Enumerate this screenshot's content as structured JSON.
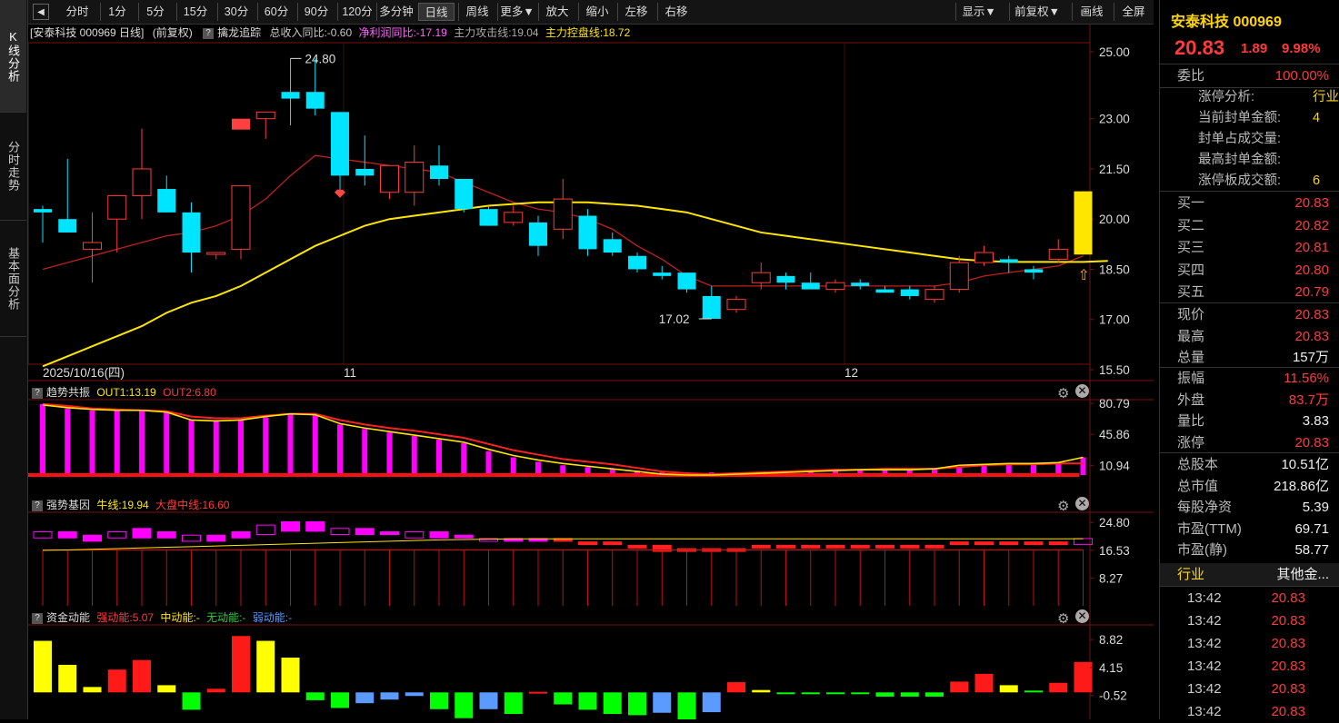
{
  "sidebar": {
    "tabs": [
      {
        "label": "K线分析",
        "active": true
      },
      {
        "label": "分时走势",
        "active": false
      },
      {
        "label": "基本面分析",
        "active": false
      }
    ]
  },
  "toolbar": {
    "back_icon": "◀",
    "periods": [
      "分时",
      "1分",
      "5分",
      "15分",
      "30分",
      "60分",
      "90分",
      "120分",
      "多分钟",
      "日线",
      "周线",
      "更多▼"
    ],
    "selected_period": "日线",
    "tools": [
      "放大",
      "缩小",
      "左移",
      "右移"
    ],
    "right_tools": [
      "显示▼",
      "前复权▼",
      "画线",
      "全屏"
    ]
  },
  "main_chart": {
    "header": {
      "stock": "[安泰科技 000969 日线]",
      "adjust": "(前复权)",
      "indicator": "擒龙追踪",
      "rev": "总收入同比:-0.60",
      "profit": "净利润同比:-17.19",
      "attack": "主力攻击线:19.04",
      "control": "主力控盘线:18.72"
    },
    "y_ticks": [
      "25.00",
      "23.00",
      "21.50",
      "20.00",
      "18.50",
      "17.00",
      "15.50"
    ],
    "high_label": "24.80",
    "low_label": "17.02",
    "date_labels": [
      "2025/10/16(四)",
      "11",
      "12"
    ]
  },
  "chart_data": [
    {
      "type": "candlestick",
      "title": "安泰科技 000969 日线",
      "ylim": [
        15.5,
        25.0
      ],
      "candles": [
        {
          "o": 20.3,
          "h": 20.4,
          "l": 19.3,
          "c": 20.2
        },
        {
          "o": 20.0,
          "h": 21.8,
          "l": 19.6,
          "c": 19.6
        },
        {
          "o": 19.1,
          "h": 20.2,
          "l": 18.1,
          "c": 19.3
        },
        {
          "o": 20.0,
          "h": 20.7,
          "l": 19.0,
          "c": 20.7
        },
        {
          "o": 20.7,
          "h": 22.7,
          "l": 20.0,
          "c": 21.5
        },
        {
          "o": 20.9,
          "h": 21.3,
          "l": 20.2,
          "c": 20.2
        },
        {
          "o": 20.2,
          "h": 20.5,
          "l": 18.4,
          "c": 19.0
        },
        {
          "o": 19.0,
          "h": 19.0,
          "l": 18.8,
          "c": 19.0
        },
        {
          "o": 19.1,
          "h": 21.0,
          "l": 18.8,
          "c": 21.0
        },
        {
          "o": 23.0,
          "h": 23.1,
          "l": 22.4,
          "c": 23.2
        },
        {
          "o": 23.8,
          "h": 24.8,
          "l": 22.8,
          "c": 23.6
        },
        {
          "o": 23.8,
          "h": 24.8,
          "l": 23.1,
          "c": 23.3
        },
        {
          "o": 23.2,
          "h": 23.2,
          "l": 20.8,
          "c": 21.3
        },
        {
          "o": 21.5,
          "h": 22.5,
          "l": 21.0,
          "c": 21.3
        },
        {
          "o": 20.8,
          "h": 21.6,
          "l": 20.6,
          "c": 21.6
        },
        {
          "o": 20.8,
          "h": 22.2,
          "l": 20.4,
          "c": 21.7
        },
        {
          "o": 21.6,
          "h": 22.2,
          "l": 21.0,
          "c": 21.2
        },
        {
          "o": 21.2,
          "h": 21.2,
          "l": 20.2,
          "c": 20.3
        },
        {
          "o": 20.3,
          "h": 20.4,
          "l": 19.8,
          "c": 19.8
        },
        {
          "o": 19.9,
          "h": 20.4,
          "l": 19.8,
          "c": 20.2
        },
        {
          "o": 19.9,
          "h": 20.1,
          "l": 18.9,
          "c": 19.2
        },
        {
          "o": 19.7,
          "h": 21.2,
          "l": 19.4,
          "c": 20.6
        },
        {
          "o": 20.1,
          "h": 20.3,
          "l": 18.9,
          "c": 19.1
        },
        {
          "o": 19.4,
          "h": 19.6,
          "l": 18.9,
          "c": 19.0
        },
        {
          "o": 18.9,
          "h": 19.0,
          "l": 18.4,
          "c": 18.5
        },
        {
          "o": 18.4,
          "h": 18.6,
          "l": 18.2,
          "c": 18.3
        },
        {
          "o": 18.4,
          "h": 18.4,
          "l": 17.8,
          "c": 17.9
        },
        {
          "o": 17.7,
          "h": 18.0,
          "l": 17.02,
          "c": 17.02
        },
        {
          "o": 17.3,
          "h": 17.7,
          "l": 17.2,
          "c": 17.6
        },
        {
          "o": 18.1,
          "h": 18.7,
          "l": 17.9,
          "c": 18.4
        },
        {
          "o": 18.3,
          "h": 18.4,
          "l": 17.9,
          "c": 18.1
        },
        {
          "o": 18.1,
          "h": 18.4,
          "l": 17.9,
          "c": 17.9
        },
        {
          "o": 17.9,
          "h": 18.2,
          "l": 17.8,
          "c": 18.1
        },
        {
          "o": 18.1,
          "h": 18.2,
          "l": 17.9,
          "c": 18.0
        },
        {
          "o": 17.9,
          "h": 18.0,
          "l": 17.8,
          "c": 17.8
        },
        {
          "o": 17.9,
          "h": 18.0,
          "l": 17.6,
          "c": 17.7
        },
        {
          "o": 17.6,
          "h": 18.0,
          "l": 17.5,
          "c": 17.9
        },
        {
          "o": 17.9,
          "h": 18.9,
          "l": 17.8,
          "c": 18.7
        },
        {
          "o": 18.7,
          "h": 19.2,
          "l": 18.6,
          "c": 19.0
        },
        {
          "o": 18.8,
          "h": 18.9,
          "l": 18.4,
          "c": 18.7
        },
        {
          "o": 18.5,
          "h": 18.6,
          "l": 18.2,
          "c": 18.4
        },
        {
          "o": 18.8,
          "h": 19.4,
          "l": 18.7,
          "c": 19.1
        },
        {
          "o": 18.94,
          "h": 20.83,
          "l": 18.94,
          "c": 20.83
        }
      ],
      "ma_fast": [
        18.5,
        18.7,
        18.9,
        19.1,
        19.3,
        19.5,
        19.6,
        19.8,
        20.1,
        20.6,
        21.3,
        21.9,
        21.8,
        21.7,
        21.6,
        21.5,
        21.4,
        21.1,
        20.8,
        20.5,
        20.3,
        20.2,
        20.0,
        19.7,
        19.2,
        18.8,
        18.3,
        18.0,
        18.0,
        18.0,
        18.0,
        18.0,
        18.0,
        18.0,
        18.0,
        18.0,
        18.0,
        18.1,
        18.3,
        18.4,
        18.5,
        18.6,
        18.9
      ],
      "ma_slow": [
        15.6,
        15.9,
        16.2,
        16.5,
        16.8,
        17.2,
        17.5,
        17.7,
        18.0,
        18.4,
        18.8,
        19.2,
        19.5,
        19.8,
        20.0,
        20.1,
        20.2,
        20.3,
        20.4,
        20.45,
        20.5,
        20.5,
        20.5,
        20.45,
        20.4,
        20.3,
        20.2,
        20.0,
        19.8,
        19.6,
        19.5,
        19.4,
        19.3,
        19.2,
        19.1,
        19.0,
        18.9,
        18.8,
        18.75,
        18.72,
        18.72,
        18.72,
        18.72,
        18.75
      ]
    },
    {
      "type": "bar",
      "title": "趋势共振",
      "series": [
        {
          "name": "OUT1",
          "value_label": "13.19"
        },
        {
          "name": "OUT2",
          "value_label": "6.80"
        }
      ],
      "y_ticks": [
        "80.79",
        "45.86",
        "10.94"
      ],
      "ylim": [
        0,
        84
      ],
      "values": [
        80,
        75,
        73,
        73,
        73,
        72,
        62,
        62,
        62,
        65,
        69,
        69,
        57,
        52,
        48,
        44,
        40,
        36,
        27,
        20,
        15,
        11,
        9,
        7,
        5,
        3,
        3,
        3,
        3,
        3,
        4,
        5,
        5,
        6,
        6,
        6,
        7,
        9,
        11,
        12,
        13,
        13,
        20
      ],
      "line1": [
        79,
        76,
        74,
        73,
        73,
        71,
        62,
        61,
        62,
        66,
        69,
        68,
        58,
        53,
        49,
        45,
        41,
        37,
        29,
        22,
        17,
        13,
        10,
        7,
        4,
        1,
        0,
        0,
        1,
        2,
        3,
        4,
        5,
        6,
        6,
        6,
        7,
        11,
        12,
        13,
        13,
        14,
        20
      ],
      "line2": [
        80,
        78,
        75,
        74,
        73,
        72,
        66,
        64,
        64,
        67,
        69,
        69,
        62,
        57,
        53,
        50,
        46,
        42,
        35,
        28,
        23,
        18,
        15,
        12,
        8,
        4,
        2,
        1,
        2,
        3,
        4,
        5,
        6,
        6,
        7,
        7,
        7,
        9,
        11,
        12,
        12,
        13,
        13
      ]
    },
    {
      "type": "bar",
      "title": "强势基因",
      "series": [
        {
          "name": "牛线",
          "value_label": "19.94"
        },
        {
          "name": "大盘中线",
          "value_label": "16.60"
        }
      ],
      "y_ticks": [
        "24.80",
        "16.53",
        "8.27"
      ],
      "ylim": [
        0,
        27
      ],
      "values_top": [
        22,
        22,
        21,
        22,
        23,
        22,
        21,
        21,
        22,
        24,
        25,
        25,
        23,
        23,
        22,
        22,
        22,
        21,
        20,
        20,
        20,
        20,
        19,
        19,
        18,
        18,
        17,
        17,
        17,
        18,
        18,
        18,
        18,
        18,
        18,
        18,
        18,
        19,
        19,
        19,
        19,
        19,
        20
      ],
      "values_bottom": [
        21,
        21,
        20,
        21,
        21,
        21,
        20,
        20,
        21,
        22,
        23,
        23,
        22,
        22,
        22,
        21,
        21,
        21,
        20,
        20,
        20,
        20,
        19,
        19,
        18,
        17,
        17,
        17,
        17,
        18,
        18,
        18,
        18,
        18,
        18,
        18,
        18,
        19,
        19,
        19,
        19,
        19,
        19
      ],
      "line_bull": [
        16.5,
        16.6,
        16.8,
        17.0,
        17.2,
        17.4,
        17.6,
        17.8,
        18.0,
        18.2,
        18.4,
        18.6,
        18.8,
        19.0,
        19.2,
        19.4,
        19.6,
        19.7,
        19.8,
        19.9,
        19.9,
        19.9,
        19.9,
        19.9,
        19.9,
        19.9,
        19.9,
        19.9,
        19.9,
        19.9,
        19.9,
        19.9,
        19.9,
        19.9,
        19.9,
        19.9,
        19.9,
        19.9,
        19.9,
        19.9,
        19.9,
        19.9,
        19.94
      ],
      "line_mid": [
        16.6,
        16.6,
        16.6,
        16.6,
        16.6,
        16.6,
        16.6,
        16.6,
        16.6,
        16.6,
        16.6,
        16.6,
        16.6,
        16.6,
        16.6,
        16.6,
        16.6,
        16.6,
        16.6,
        16.6,
        16.6,
        16.6,
        16.6,
        16.6,
        16.6,
        16.6,
        16.6,
        16.6,
        16.6,
        16.6,
        16.6,
        16.6,
        16.6,
        16.6,
        16.6,
        16.6,
        16.6,
        16.6,
        16.6,
        16.6,
        16.6,
        16.6,
        16.6
      ]
    },
    {
      "type": "bar",
      "title": "资金动能",
      "series": [
        {
          "name": "强动能",
          "value_label": "5.07"
        },
        {
          "name": "中动能",
          "value_label": "-"
        },
        {
          "name": "无动能",
          "value_label": "-"
        },
        {
          "name": "弱动能",
          "value_label": "-"
        }
      ],
      "y_ticks": [
        "8.82",
        "4.15",
        "-0.52"
      ],
      "ylim": [
        -4.5,
        10.5
      ],
      "values": [
        8.6,
        4.6,
        0.9,
        3.8,
        5.4,
        1.2,
        -2.9,
        0.6,
        9.4,
        8.6,
        5.8,
        -1.3,
        -2.6,
        -1.8,
        -1.2,
        -0.6,
        -2.8,
        -4.3,
        -2.8,
        -3.6,
        0.1,
        -2.0,
        -2.9,
        -3.6,
        -3.8,
        -3.4,
        -4.5,
        -3.3,
        1.7,
        0.4,
        -0.2,
        -0.2,
        -0.2,
        -0.2,
        -0.7,
        -0.7,
        -0.7,
        1.8,
        3.1,
        1.2,
        0.3,
        1.6,
        5.07
      ],
      "colors": [
        "yellow",
        "yellow",
        "yellow",
        "red",
        "red",
        "yellow",
        "green",
        "red",
        "red",
        "yellow",
        "yellow",
        "green",
        "green",
        "blue",
        "blue",
        "blue",
        "green",
        "green",
        "blue",
        "green",
        "red",
        "green",
        "green",
        "green",
        "green",
        "blue",
        "green",
        "blue",
        "red",
        "yellow",
        "green",
        "green",
        "green",
        "green",
        "green",
        "green",
        "green",
        "red",
        "red",
        "yellow",
        "green",
        "red",
        "red"
      ]
    }
  ],
  "panels": {
    "trend": {
      "title": "趋势共振",
      "out1": "OUT1:13.19",
      "out2": "OUT2:6.80"
    },
    "gene": {
      "title": "强势基因",
      "bull": "牛线:19.94",
      "mid": "大盘中线:16.60"
    },
    "fund": {
      "title": "资金动能",
      "strong": "强动能:5.07",
      "medium": "中动能:-",
      "none": "无动能:-",
      "weak": "弱动能:-"
    }
  },
  "right_panel": {
    "title": "安泰科技 000969",
    "price": "20.83",
    "change": "1.89",
    "pct": "9.98%",
    "weibi_label": "委比",
    "weibi_value": "100.00%",
    "limit_info": [
      {
        "label": "涨停分析:",
        "value": "行业"
      },
      {
        "label": "当前封单金额:",
        "value": "4"
      },
      {
        "label": "封单占成交量:",
        "value": ""
      },
      {
        "label": "最高封单金额:",
        "value": ""
      },
      {
        "label": "涨停板成交额:",
        "value": "6"
      }
    ],
    "bids": [
      {
        "label": "买一",
        "value": "20.83"
      },
      {
        "label": "买二",
        "value": "20.82"
      },
      {
        "label": "买三",
        "value": "20.81"
      },
      {
        "label": "买四",
        "value": "20.80"
      },
      {
        "label": "买五",
        "value": "20.79"
      }
    ],
    "quotes": [
      {
        "label": "现价",
        "value": "20.83",
        "color": "red"
      },
      {
        "label": "最高",
        "value": "20.83",
        "color": "red"
      },
      {
        "label": "总量",
        "value": "157万",
        "color": "white"
      }
    ],
    "stats": [
      {
        "label": "振幅",
        "value": "11.56%",
        "color": "red"
      },
      {
        "label": "外盘",
        "value": "83.7万",
        "color": "red"
      },
      {
        "label": "量比",
        "value": "3.83",
        "color": "white"
      },
      {
        "label": "涨停",
        "value": "20.83",
        "color": "red"
      }
    ],
    "fundamentals": [
      {
        "label": "总股本",
        "value": "10.51亿"
      },
      {
        "label": "总市值",
        "value": "218.86亿"
      },
      {
        "label": "每股净资",
        "value": "5.39"
      },
      {
        "label": "市盈(TTM)",
        "value": "69.71"
      },
      {
        "label": "市盈(静)",
        "value": "58.77"
      }
    ],
    "industry_label": "行业",
    "industry_value": "其他金...",
    "ticks": [
      {
        "time": "13:42",
        "price": "20.83"
      },
      {
        "time": "13:42",
        "price": "20.83"
      },
      {
        "time": "13:42",
        "price": "20.83"
      },
      {
        "time": "13:42",
        "price": "20.83"
      },
      {
        "time": "13:42",
        "price": "20.83"
      },
      {
        "time": "13:42",
        "price": "20.83"
      }
    ]
  },
  "colors": {
    "up": "#ff3b3b",
    "down": "#00e5ff",
    "ma_yellow": "#ffe600",
    "ma_gray": "#9a9a9a",
    "magenta": "#ff00ff",
    "fund_yellow": "#ffff00",
    "fund_green": "#00ff00",
    "fund_blue": "#5b9bff"
  }
}
